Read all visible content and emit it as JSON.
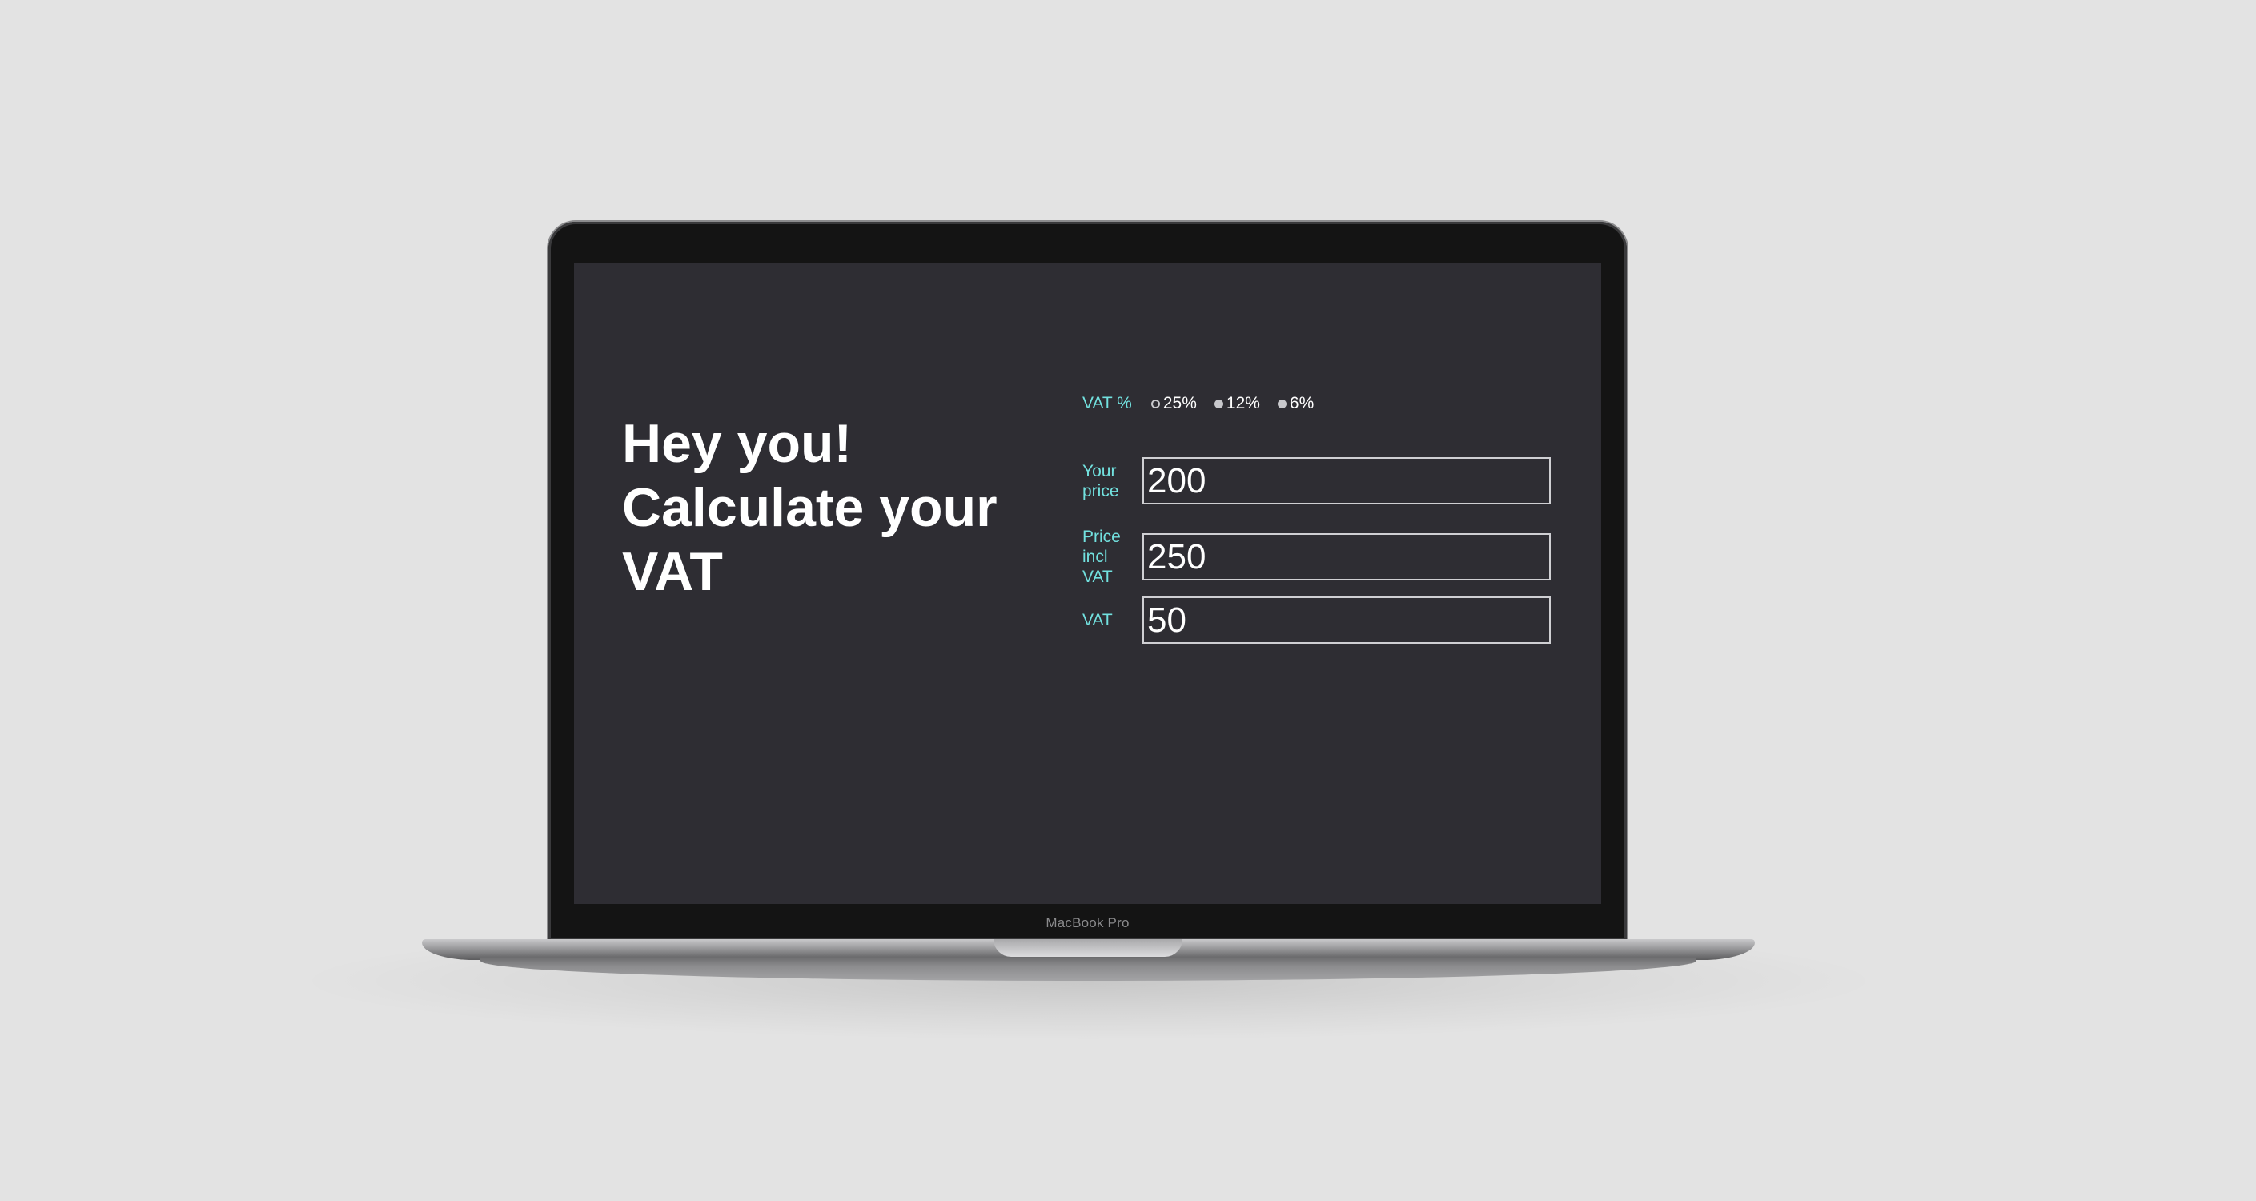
{
  "device": {
    "model_label": "MacBook Pro"
  },
  "app": {
    "headline": "Hey you! Calculate your VAT",
    "vat": {
      "label": "VAT %",
      "options": [
        {
          "label": "25%",
          "selected": true
        },
        {
          "label": "12%",
          "selected": false
        },
        {
          "label": "6%",
          "selected": false
        }
      ]
    },
    "fields": {
      "your_price": {
        "label": "Your price",
        "value": "200"
      },
      "price_incl_vat": {
        "label": "Price incl VAT",
        "value": "250"
      },
      "vat": {
        "label": "VAT",
        "value": "50"
      }
    }
  },
  "colors": {
    "background": "#e3e3e3",
    "screen": "#2e2d33",
    "accent": "#72e1df",
    "text": "#ffffff"
  }
}
